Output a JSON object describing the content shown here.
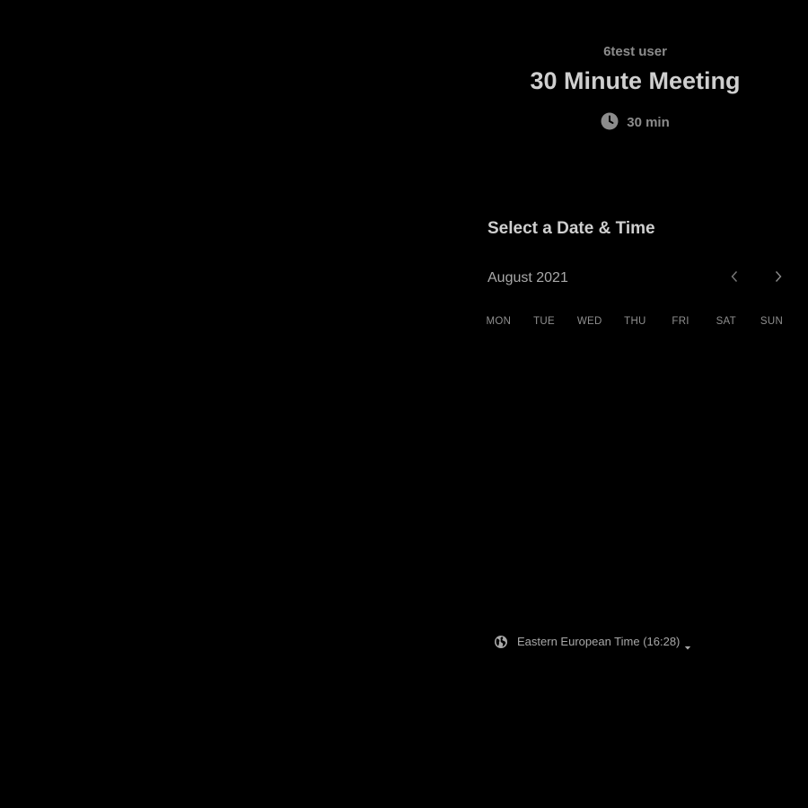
{
  "event": {
    "host": "6test user",
    "title": "30 Minute Meeting",
    "duration": "30 min"
  },
  "scheduler": {
    "heading": "Select a Date & Time",
    "month": "August 2021",
    "weekdays": [
      "MON",
      "TUE",
      "WED",
      "THU",
      "FRI",
      "SAT",
      "SUN"
    ]
  },
  "timezone": {
    "label": "Eastern European Time (16:28)"
  },
  "icons": {
    "clock": "clock-icon",
    "prev": "chevron-left-icon",
    "next": "chevron-right-icon",
    "globe": "globe-icon",
    "caret": "caret-down-icon"
  },
  "colors": {
    "background": "#000000",
    "title": "#cfcfcf",
    "muted": "#8c8c8c"
  }
}
